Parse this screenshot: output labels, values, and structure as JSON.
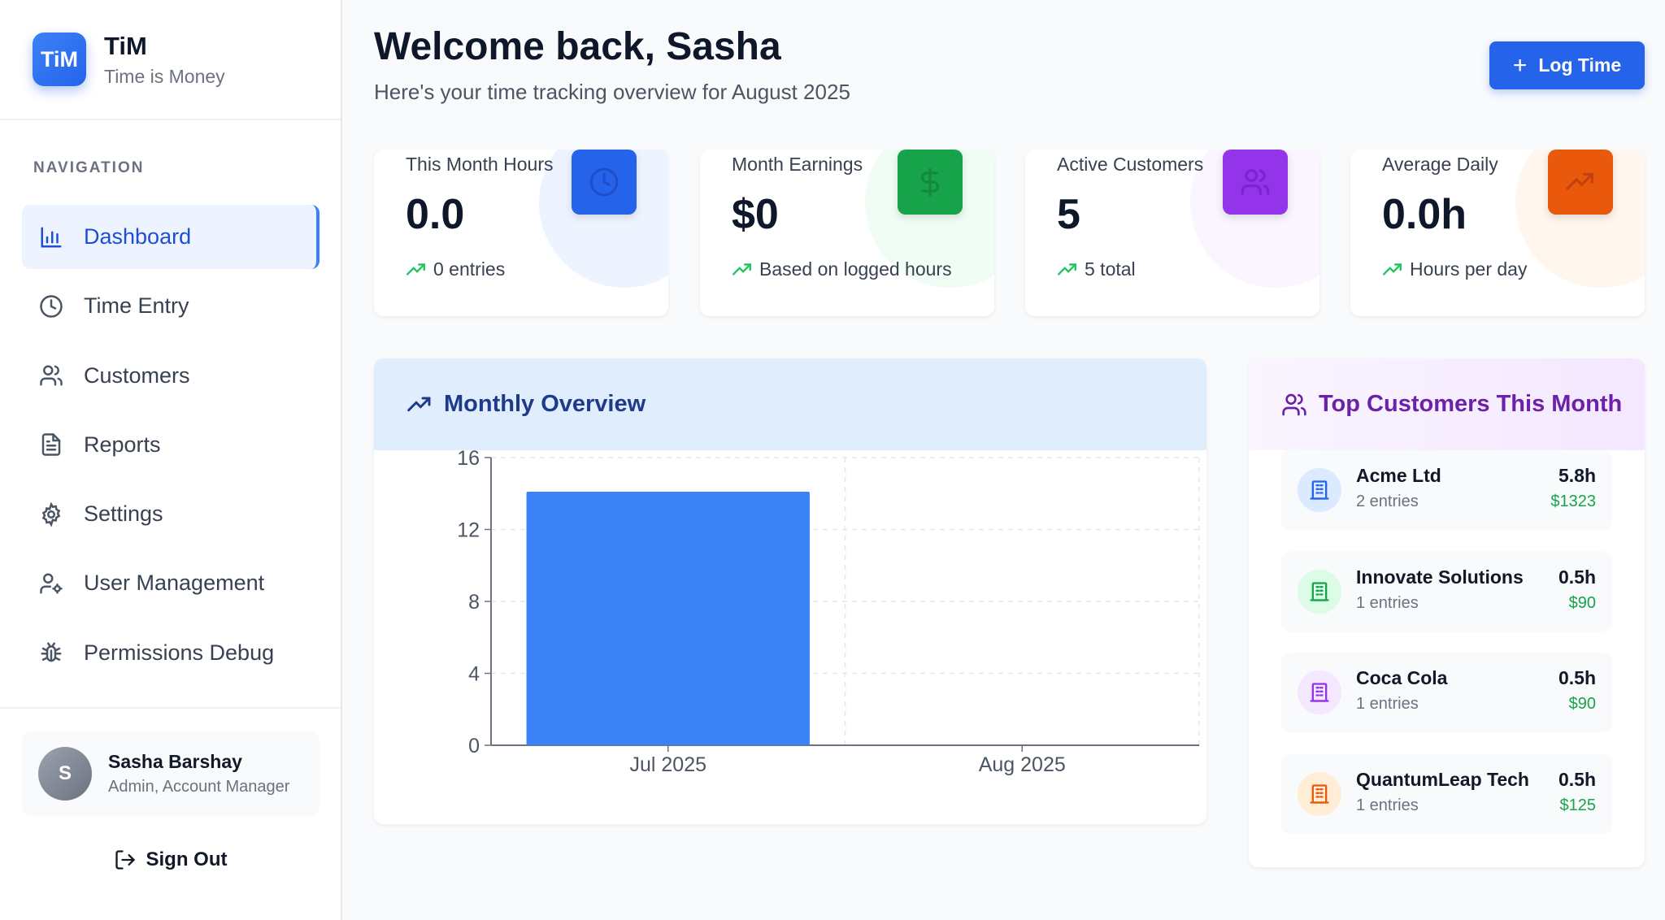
{
  "brand": {
    "logo": "TiM",
    "name": "TiM",
    "subtitle": "Time is Money"
  },
  "nav": {
    "title": "NAVIGATION",
    "items": [
      {
        "label": "Dashboard",
        "icon": "bar-chart-icon",
        "active": true
      },
      {
        "label": "Time Entry",
        "icon": "clock-icon"
      },
      {
        "label": "Customers",
        "icon": "users-icon"
      },
      {
        "label": "Reports",
        "icon": "file-text-icon"
      },
      {
        "label": "Settings",
        "icon": "gear-icon"
      },
      {
        "label": "User Management",
        "icon": "user-cog-icon"
      },
      {
        "label": "Permissions Debug",
        "icon": "bug-icon"
      }
    ]
  },
  "user": {
    "initial": "S",
    "name": "Sasha Barshay",
    "role": "Admin, Account Manager"
  },
  "signout_label": "Sign Out",
  "header": {
    "welcome": "Welcome back, Sasha",
    "subtitle": "Here's your time tracking overview for August 2025",
    "log_time": "Log Time"
  },
  "stats": [
    {
      "label": "This Month Hours",
      "value": "0.0",
      "foot": "0 entries",
      "icon": "clock-icon",
      "color": "#2563eb"
    },
    {
      "label": "Month Earnings",
      "value": "$0",
      "foot": "Based on logged hours",
      "icon": "dollar-icon",
      "color": "#16a34a"
    },
    {
      "label": "Active Customers",
      "value": "5",
      "foot": "5 total",
      "icon": "users-icon",
      "color": "#9333ea"
    },
    {
      "label": "Average Daily",
      "value": "0.0h",
      "foot": "Hours per day",
      "icon": "trend-up-icon",
      "color": "#ea580c"
    }
  ],
  "overview": {
    "title": "Monthly Overview"
  },
  "chart_data": {
    "type": "bar",
    "title": "Monthly Overview",
    "categories": [
      "Jul 2025",
      "Aug 2025"
    ],
    "values": [
      14.1,
      0
    ],
    "yticks": [
      "0",
      "4",
      "8",
      "12",
      "16"
    ],
    "ylim": [
      0,
      16
    ],
    "grid": true,
    "bar_color": "#3b82f6"
  },
  "top_customers": {
    "title": "Top Customers This Month",
    "items": [
      {
        "name": "Acme Ltd",
        "entries": "2 entries",
        "hours": "5.8h",
        "amount": "$1323",
        "color": "#2563eb",
        "bg": "#dbeafe"
      },
      {
        "name": "Innovate Solutions",
        "entries": "1 entries",
        "hours": "0.5h",
        "amount": "$90",
        "color": "#16a34a",
        "bg": "#dcfce7"
      },
      {
        "name": "Coca Cola",
        "entries": "1 entries",
        "hours": "0.5h",
        "amount": "$90",
        "color": "#9333ea",
        "bg": "#f3e8ff"
      },
      {
        "name": "QuantumLeap Tech",
        "entries": "1 entries",
        "hours": "0.5h",
        "amount": "$125",
        "color": "#ea580c",
        "bg": "#ffedd5"
      }
    ]
  }
}
